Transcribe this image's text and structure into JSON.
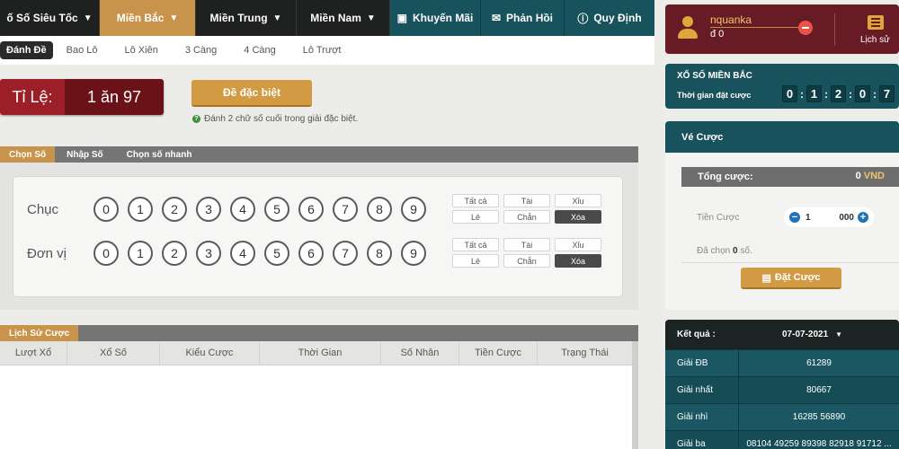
{
  "nav": {
    "items": [
      {
        "label": "ố Số Siêu Tốc",
        "chevron": true
      },
      {
        "label": "Miền Bắc",
        "chevron": true,
        "active": true
      },
      {
        "label": "Miền Trung",
        "chevron": true
      },
      {
        "label": "Miền Nam",
        "chevron": true
      }
    ],
    "promo": {
      "label": "Khuyến Mãi",
      "icon": "gift-icon"
    },
    "feedback": {
      "label": "Phản Hồi",
      "icon": "chat-icon"
    },
    "rules": {
      "label": "Quy Định",
      "icon": "info-icon"
    }
  },
  "subnav": [
    "Đánh Đề",
    "Bao Lô",
    "Lô Xiên",
    "3 Càng",
    "4 Càng",
    "Lô Trượt"
  ],
  "odds": {
    "label": "Tỉ Lệ:",
    "value": "1 ăn 97"
  },
  "special_button": "Đề đặc biệt",
  "hint": "Đánh 2 chữ số cuối trong giải đặc biệt.",
  "panel_tabs": [
    "Chọn Số",
    "Nhập Số",
    "Chọn số nhanh"
  ],
  "rows": [
    {
      "label": "Chục",
      "digits": [
        "0",
        "1",
        "2",
        "3",
        "4",
        "5",
        "6",
        "7",
        "8",
        "9"
      ]
    },
    {
      "label": "Đơn vị",
      "digits": [
        "0",
        "1",
        "2",
        "3",
        "4",
        "5",
        "6",
        "7",
        "8",
        "9"
      ]
    }
  ],
  "quick_buttons": [
    "Tất cả",
    "Tài",
    "Xỉu",
    "Lẻ",
    "Chẵn",
    "Xóa"
  ],
  "history": {
    "tab": "Lịch Sử Cược",
    "columns": [
      "Lượt Xổ",
      "Xổ Số",
      "Kiểu Cược",
      "Thời Gian",
      "Số Nhân",
      "Tiền Cược",
      "Trạng Thái"
    ]
  },
  "user": {
    "name": "nquanka",
    "balance": "đ 0",
    "history_label": "Lịch sử"
  },
  "draw": {
    "title": "XỔ SỐ MIỀN BẮC",
    "time_label": "Thời gian đặt cược",
    "timer": [
      "0",
      "1",
      "2",
      "0",
      "7"
    ]
  },
  "bet": {
    "title": "Vé Cược",
    "total_label": "Tổng cược:",
    "total_value": "0",
    "currency": "VND",
    "stake_label": "Tiền Cược",
    "stake_value": "1",
    "stake_unit": "000",
    "chosen_prefix": "Đã chọn",
    "chosen_count": "0",
    "chosen_suffix": "số.",
    "place_label": "Đặt Cược"
  },
  "results": {
    "title": "Kết quả :",
    "date": "07-07-2021",
    "rows": [
      {
        "name": "Giải ĐB",
        "value": "61289"
      },
      {
        "name": "Giải nhất",
        "value": "80667"
      },
      {
        "name": "Giải nhì",
        "value": "16285 56890"
      },
      {
        "name": "Giải ba",
        "value": "08104 49259 89398 82918 91712 ..."
      }
    ]
  },
  "colors": {
    "accent": "#c8944c",
    "teal": "#18525c",
    "maroon": "#671c25"
  }
}
